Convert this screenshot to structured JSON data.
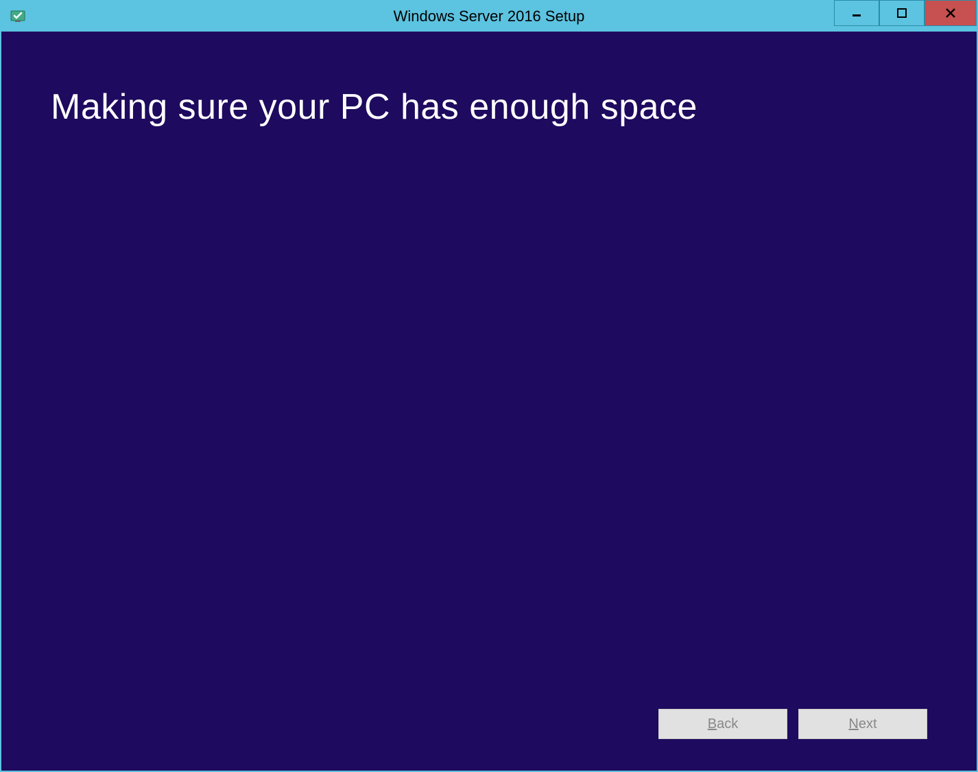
{
  "window": {
    "title": "Windows Server 2016 Setup"
  },
  "main": {
    "heading": "Making sure your PC has enough space"
  },
  "buttons": {
    "back": "Back",
    "back_accesskey": "B",
    "next": "Next",
    "next_accesskey": "N"
  }
}
